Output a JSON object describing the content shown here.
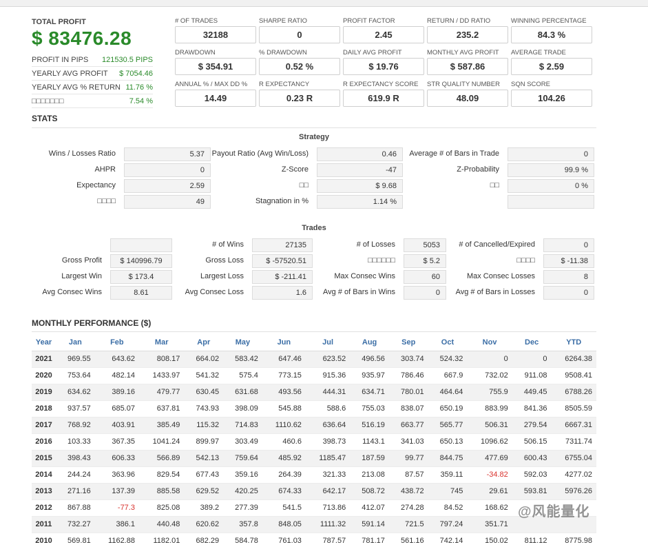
{
  "profit": {
    "label": "TOTAL PROFIT",
    "value": "$ 83476.28",
    "stats": [
      {
        "label": "PROFIT IN PIPS",
        "value": "121530.5 PIPS"
      },
      {
        "label": "YEARLY AVG PROFIT",
        "value": "$ 7054.46"
      },
      {
        "label": "YEARLY AVG % RETURN",
        "value": "11.76 %"
      },
      {
        "label": "□□□□□□□",
        "value": "7.54 %"
      }
    ]
  },
  "kpis": [
    {
      "label": "# OF TRADES",
      "value": "32188"
    },
    {
      "label": "SHARPE RATIO",
      "value": "0"
    },
    {
      "label": "PROFIT FACTOR",
      "value": "2.45"
    },
    {
      "label": "RETURN / DD RATIO",
      "value": "235.2"
    },
    {
      "label": "WINNING PERCENTAGE",
      "value": "84.3 %"
    },
    {
      "label": "DRAWDOWN",
      "value": "$ 354.91"
    },
    {
      "label": "% DRAWDOWN",
      "value": "0.52 %"
    },
    {
      "label": "DAILY AVG PROFIT",
      "value": "$ 19.76"
    },
    {
      "label": "MONTHLY AVG PROFIT",
      "value": "$ 587.86"
    },
    {
      "label": "AVERAGE TRADE",
      "value": "$ 2.59"
    },
    {
      "label": "ANNUAL % / MAX DD %",
      "value": "14.49"
    },
    {
      "label": "R EXPECTANCY",
      "value": "0.23 R"
    },
    {
      "label": "R EXPECTANCY SCORE",
      "value": "619.9 R"
    },
    {
      "label": "STR QUALITY NUMBER",
      "value": "48.09"
    },
    {
      "label": "SQN SCORE",
      "value": "104.26"
    }
  ],
  "stats_title": "STATS",
  "strategy": {
    "title": "Strategy",
    "rows": [
      [
        {
          "label": "Wins / Losses Ratio",
          "value": "5.37"
        },
        {
          "label": "Payout Ratio (Avg Win/Loss)",
          "value": "0.46"
        },
        {
          "label": "Average # of Bars in Trade",
          "value": "0"
        }
      ],
      [
        {
          "label": "AHPR",
          "value": "0"
        },
        {
          "label": "Z-Score",
          "value": "-47"
        },
        {
          "label": "Z-Probability",
          "value": "99.9 %"
        }
      ],
      [
        {
          "label": "Expectancy",
          "value": "2.59"
        },
        {
          "label": "□□",
          "value": "$ 9.68"
        },
        {
          "label": "□□",
          "value": "0 %"
        }
      ],
      [
        {
          "label": "□□□□",
          "value": "49"
        },
        {
          "label": "Stagnation in %",
          "value": "1.14 %"
        },
        {
          "label": "",
          "value": ""
        }
      ]
    ]
  },
  "trades": {
    "title": "Trades",
    "rows": [
      [
        {
          "label": "",
          "value": ""
        },
        {
          "label": "# of Wins",
          "value": "27135"
        },
        {
          "label": "# of Losses",
          "value": "5053"
        },
        {
          "label": "# of Cancelled/Expired",
          "value": "0"
        }
      ],
      [
        {
          "label": "Gross Profit",
          "value": "$ 140996.79"
        },
        {
          "label": "Gross Loss",
          "value": "$ -57520.51"
        },
        {
          "label": "□□□□□□",
          "value": "$ 5.2"
        },
        {
          "label": "□□□□",
          "value": "$ -11.38"
        }
      ],
      [
        {
          "label": "Largest Win",
          "value": "$ 173.4"
        },
        {
          "label": "Largest Loss",
          "value": "$ -211.41"
        },
        {
          "label": "Max Consec Wins",
          "value": "60"
        },
        {
          "label": "Max Consec Losses",
          "value": "8"
        }
      ],
      [
        {
          "label": "Avg Consec Wins",
          "value": "8.61"
        },
        {
          "label": "Avg Consec Loss",
          "value": "1.6"
        },
        {
          "label": "Avg # of Bars in Wins",
          "value": "0"
        },
        {
          "label": "Avg # of Bars in Losses",
          "value": "0"
        }
      ]
    ]
  },
  "monthly": {
    "title": "MONTHLY PERFORMANCE ($)",
    "headers": [
      "Year",
      "Jan",
      "Feb",
      "Mar",
      "Apr",
      "May",
      "Jun",
      "Jul",
      "Aug",
      "Sep",
      "Oct",
      "Nov",
      "Dec",
      "YTD"
    ],
    "rows": [
      [
        "2021",
        "969.55",
        "643.62",
        "808.17",
        "664.02",
        "583.42",
        "647.46",
        "623.52",
        "496.56",
        "303.74",
        "524.32",
        "0",
        "0",
        "6264.38"
      ],
      [
        "2020",
        "753.64",
        "482.14",
        "1433.97",
        "541.32",
        "575.4",
        "773.15",
        "915.36",
        "935.97",
        "786.46",
        "667.9",
        "732.02",
        "911.08",
        "9508.41"
      ],
      [
        "2019",
        "634.62",
        "389.16",
        "479.77",
        "630.45",
        "631.68",
        "493.56",
        "444.31",
        "634.71",
        "780.01",
        "464.64",
        "755.9",
        "449.45",
        "6788.26"
      ],
      [
        "2018",
        "937.57",
        "685.07",
        "637.81",
        "743.93",
        "398.09",
        "545.88",
        "588.6",
        "755.03",
        "838.07",
        "650.19",
        "883.99",
        "841.36",
        "8505.59"
      ],
      [
        "2017",
        "768.92",
        "403.91",
        "385.49",
        "115.32",
        "714.83",
        "1110.62",
        "636.64",
        "516.19",
        "663.77",
        "565.77",
        "506.31",
        "279.54",
        "6667.31"
      ],
      [
        "2016",
        "103.33",
        "367.35",
        "1041.24",
        "899.97",
        "303.49",
        "460.6",
        "398.73",
        "1143.1",
        "341.03",
        "650.13",
        "1096.62",
        "506.15",
        "7311.74"
      ],
      [
        "2015",
        "398.43",
        "606.33",
        "566.89",
        "542.13",
        "759.64",
        "485.92",
        "1185.47",
        "187.59",
        "99.77",
        "844.75",
        "477.69",
        "600.43",
        "6755.04"
      ],
      [
        "2014",
        "244.24",
        "363.96",
        "829.54",
        "677.43",
        "359.16",
        "264.39",
        "321.33",
        "213.08",
        "87.57",
        "359.11",
        "-34.82",
        "592.03",
        "4277.02"
      ],
      [
        "2013",
        "271.16",
        "137.39",
        "885.58",
        "629.52",
        "420.25",
        "674.33",
        "642.17",
        "508.72",
        "438.72",
        "745",
        "29.61",
        "593.81",
        "5976.26"
      ],
      [
        "2012",
        "867.88",
        "-77.3",
        "825.08",
        "389.2",
        "277.39",
        "541.5",
        "713.86",
        "412.07",
        "274.28",
        "84.52",
        "168.62",
        "",
        ""
      ],
      [
        "2011",
        "732.27",
        "386.1",
        "440.48",
        "620.62",
        "357.8",
        "848.05",
        "1111.32",
        "591.14",
        "721.5",
        "797.24",
        "351.71",
        "",
        ""
      ],
      [
        "2010",
        "569.81",
        "1162.88",
        "1182.01",
        "682.29",
        "584.78",
        "761.03",
        "787.57",
        "781.17",
        "561.16",
        "742.14",
        "150.02",
        "811.12",
        "8775.98"
      ]
    ]
  },
  "watermark": "@风能量化",
  "colors": {
    "profit_green": "#2a8a2a",
    "header_blue": "#3b6ea6",
    "negative_red": "#d9322d"
  }
}
